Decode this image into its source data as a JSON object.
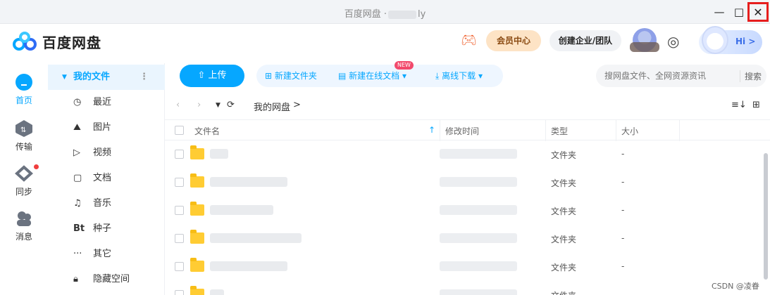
{
  "window": {
    "title_left": "百度网盘 ·",
    "title_right": "ly",
    "minimize": "—",
    "maximize": "□",
    "close": "✕"
  },
  "header": {
    "logo_text": "百度网盘",
    "vip_label": "会员中心",
    "team_label": "创建企业/团队",
    "hi_label": "Hi >"
  },
  "leftnav": [
    {
      "label": "首页",
      "icon": "cloud-icon"
    },
    {
      "label": "传输",
      "icon": "transfer-icon"
    },
    {
      "label": "同步",
      "icon": "sync-icon"
    },
    {
      "label": "消息",
      "icon": "message-icon"
    }
  ],
  "sidebar": {
    "active": "我的文件",
    "items": [
      {
        "label": "最近",
        "icon": "◷"
      },
      {
        "label": "图片",
        "icon": "⛰"
      },
      {
        "label": "视频",
        "icon": "▷"
      },
      {
        "label": "文档",
        "icon": "▢"
      },
      {
        "label": "音乐",
        "icon": "♫"
      },
      {
        "label": "种子",
        "icon": "Bt"
      },
      {
        "label": "其它",
        "icon": "···"
      },
      {
        "label": "隐藏空间",
        "icon": "🔒︎"
      }
    ]
  },
  "toolbar": {
    "upload": "上传",
    "new_folder": "新建文件夹",
    "new_doc": "新建在线文档",
    "new_badge": "NEW",
    "offline": "离线下载",
    "search_placeholder": "搜网盘文件、全网资源资讯",
    "search_btn": "搜索"
  },
  "breadcrumb": {
    "path": "我的网盘",
    "sep": ">"
  },
  "table": {
    "headers": {
      "name": "文件名",
      "time": "修改时间",
      "type": "类型",
      "size": "大小"
    },
    "rows": [
      {
        "type": "文件夹",
        "size": "-"
      },
      {
        "type": "文件夹",
        "size": "-"
      },
      {
        "type": "文件夹",
        "size": "-"
      },
      {
        "type": "文件夹",
        "size": "-"
      },
      {
        "type": "文件夹",
        "size": "-"
      },
      {
        "type": "文件夹",
        "size": ""
      }
    ]
  },
  "watermark": "CSDN @凌眷",
  "colors": {
    "accent": "#06a7ff",
    "close_highlight": "#e61e1e",
    "folder": "#ffcc33"
  }
}
